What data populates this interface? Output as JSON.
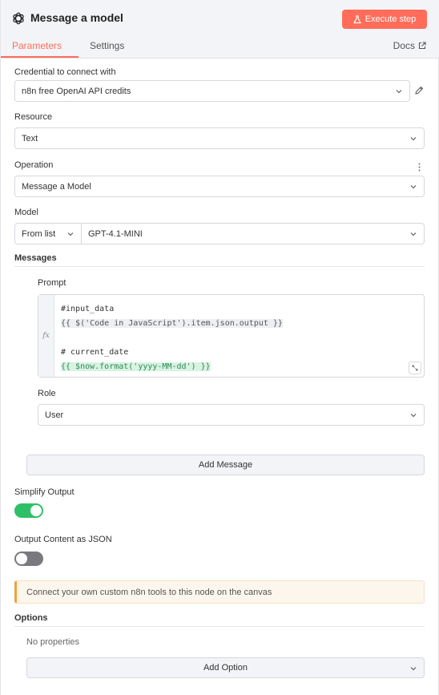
{
  "header": {
    "title": "Message a model",
    "execute_label": "Execute step",
    "tabs": [
      {
        "label": "Parameters",
        "active": true
      },
      {
        "label": "Settings",
        "active": false
      }
    ],
    "docs_label": "Docs"
  },
  "credential": {
    "label": "Credential to connect with",
    "value": "n8n free OpenAI API credits"
  },
  "resource": {
    "label": "Resource",
    "value": "Text"
  },
  "operation": {
    "label": "Operation",
    "value": "Message a Model"
  },
  "model": {
    "label": "Model",
    "mode": "From list",
    "value": "GPT-4.1-MINI"
  },
  "messages": {
    "label": "Messages",
    "prompt_label": "Prompt",
    "fx_label": "fx",
    "prompt_lines": [
      {
        "text": "#input_data",
        "style": "plain"
      },
      {
        "text": "{{ $('Code in JavaScript').item.json.output }}",
        "style": "expr"
      },
      {
        "text": "# current_date",
        "style": "plain"
      },
      {
        "text": "{{ $now.format('yyyy-MM-dd') }}",
        "style": "green"
      }
    ],
    "role_label": "Role",
    "role_value": "User",
    "add_message_label": "Add Message"
  },
  "simplify_output": {
    "label": "Simplify Output",
    "enabled": true
  },
  "output_json": {
    "label": "Output Content as JSON",
    "enabled": false
  },
  "notice": {
    "text": "Connect your own custom n8n tools to this node on the canvas"
  },
  "options": {
    "label": "Options",
    "empty_text": "No properties",
    "add_option_label": "Add Option"
  },
  "colors": {
    "accent": "#ff6d5a",
    "toggle_on": "#2fc067",
    "toggle_off": "#7a7a7e",
    "notice_border": "#f0a43c"
  },
  "icons": [
    "openai-logo-icon",
    "flask-icon",
    "external-link-icon",
    "chevron-down-icon",
    "pencil-icon",
    "more-vertical-icon",
    "expand-icon"
  ]
}
